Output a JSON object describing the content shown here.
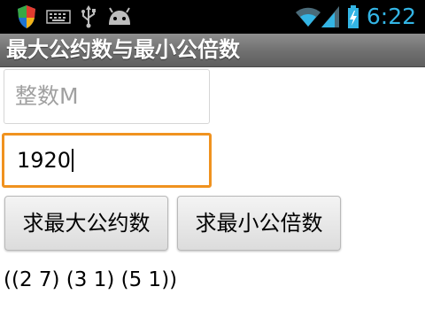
{
  "status_bar": {
    "time": "6:22",
    "icons": [
      "shield-icon",
      "keyboard-icon",
      "usb-icon",
      "android-icon",
      "wifi-icon",
      "signal-icon",
      "battery-charging-icon"
    ],
    "time_color": "#33b5e5"
  },
  "app": {
    "title": "最大公约数与最小公倍数"
  },
  "form": {
    "m_placeholder": "整数M",
    "m_value": "",
    "n_value": "1920"
  },
  "buttons": {
    "gcd_label": "求最大公约数",
    "lcm_label": "求最小公倍数"
  },
  "result": {
    "text": "((2 7) (3 1) (5 1))"
  },
  "colors": {
    "focus_border": "#f0921f",
    "accent": "#33b5e5"
  }
}
